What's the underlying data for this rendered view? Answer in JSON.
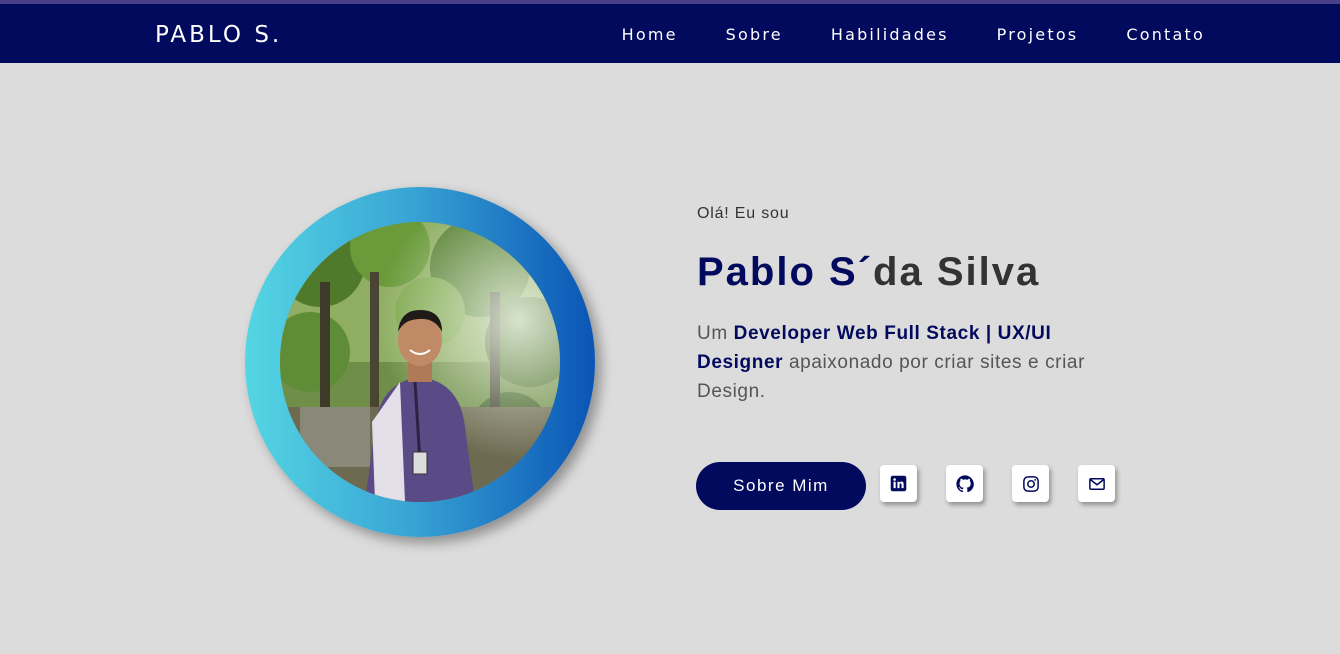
{
  "header": {
    "logo": "PABLO S.",
    "nav": [
      "Home",
      "Sobre",
      "Habilidades",
      "Projetos",
      "Contato"
    ]
  },
  "hero": {
    "greeting": "Olá! Eu sou",
    "name_first": "Pablo S´",
    "name_rest": "da Silva",
    "desc_prefix": "Um ",
    "desc_highlight": "Developer Web Full Stack | UX/UI Designer",
    "desc_suffix": " apaixonado por criar sites e criar Design.",
    "button_label": "Sobre Mim"
  },
  "social": [
    "linkedin-icon",
    "github-icon",
    "instagram-icon",
    "mail-icon"
  ],
  "colors": {
    "primary": "#020a5e",
    "background": "#dcdcdc",
    "ring_start": "#55d6e3",
    "ring_end": "#0a55b5"
  }
}
